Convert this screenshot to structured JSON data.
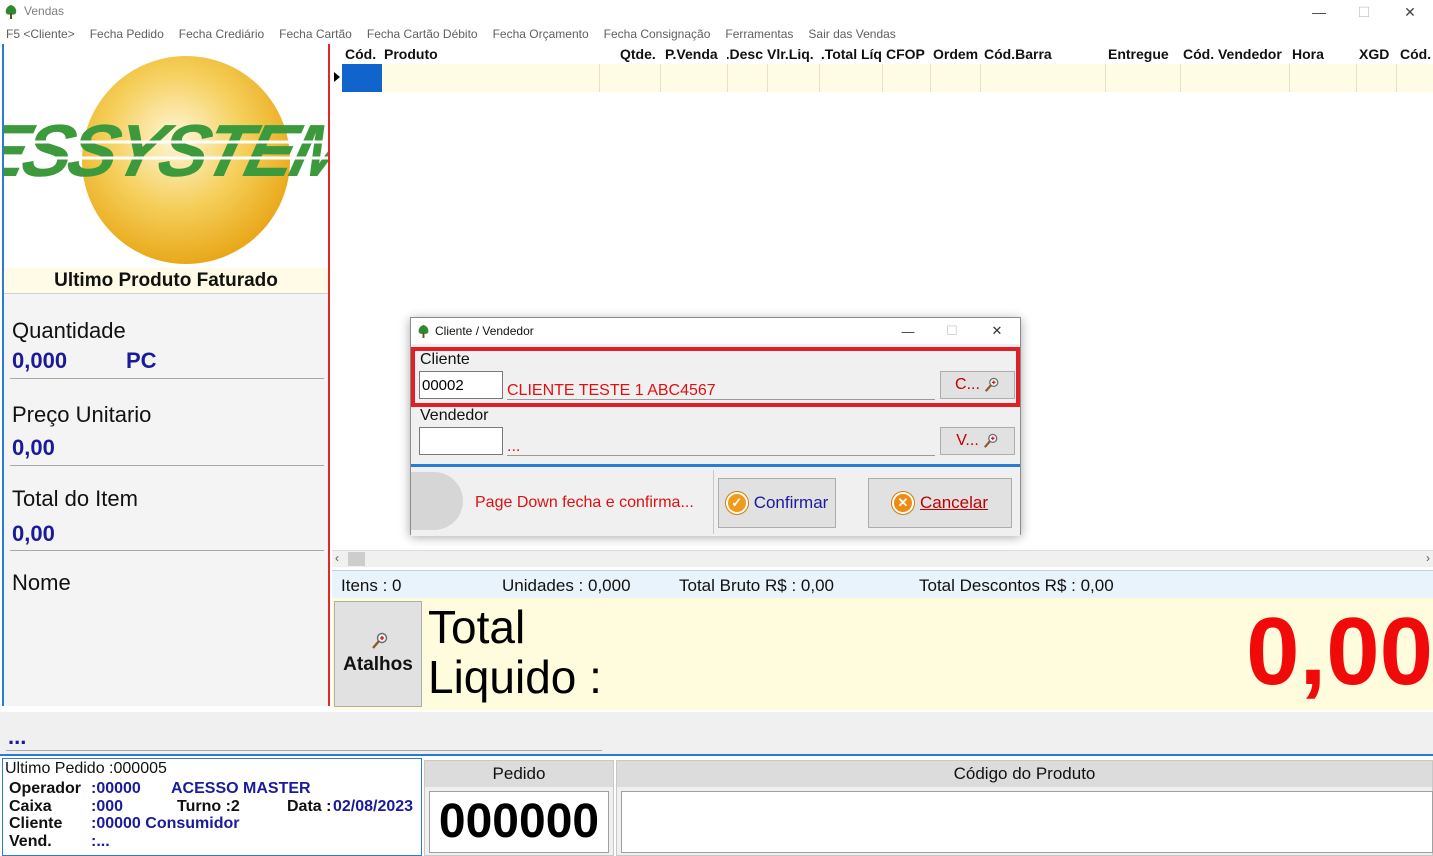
{
  "window": {
    "title": "Vendas",
    "minimize": "—",
    "maximize": "☐",
    "close": "✕"
  },
  "menu": [
    "F5 <Cliente>",
    "Fecha Pedido",
    "Fecha Crediário",
    "Fecha Cartão",
    "Fecha Cartão Débito",
    "Fecha Orçamento",
    "Fecha Consignação",
    "Ferramentas",
    "Sair das Vendas"
  ],
  "left_panel": {
    "last_product_title": "Ultimo Produto Faturado",
    "quantidade_label": "Quantidade",
    "quantidade_value": "0,000",
    "unit": "PC",
    "preco_label": "Preço Unitario",
    "preco_value": "0,00",
    "total_item_label": "Total do Item",
    "total_item_value": "0,00",
    "nome_label": "Nome"
  },
  "grid": {
    "columns": [
      "Cód.",
      "Produto",
      "Qtde.",
      "P.Venda",
      "Desc.",
      "Vlr.Liq.",
      "Total Líq.",
      "CFOP",
      "Ordem",
      "Cód.Barra",
      "Entregue",
      "Cód. Vendedor",
      "Hora",
      "XGD",
      "Cód."
    ]
  },
  "totals": {
    "itens": "Itens : 0",
    "unidades": "Unidades : 0,000",
    "total_bruto": "Total Bruto R$ : 0,00",
    "total_descontos": "Total Descontos R$ : 0,00"
  },
  "liquido": {
    "atalhos_label": "Atalhos",
    "label_line1": "Total",
    "label_line2": "Liquido :",
    "value": "0,00"
  },
  "status_text": "...",
  "info": {
    "ultimo_pedido": "Ultimo Pedido :000005",
    "operador_label": "Operador",
    "operador_value": ":00000",
    "operador_name": "ACESSO MASTER",
    "caixa_label": "Caixa",
    "caixa_value": ":000",
    "turno": "Turno :2",
    "data_label": "Data :",
    "data_value": "02/08/2023",
    "cliente_label": "Cliente",
    "cliente_value": ":00000 Consumidor",
    "vend_label": "Vend.",
    "vend_value": ":..."
  },
  "pedido": {
    "label": "Pedido",
    "value": "000000"
  },
  "codigo_produto": {
    "label": "Código do Produto",
    "value": ""
  },
  "dialog": {
    "title": "Cliente / Vendedor",
    "cliente_label": "Cliente",
    "cliente_code": "00002",
    "cliente_name": "CLIENTE TESTE 1 ABC4567",
    "cliente_btn": "C...",
    "vendedor_label": "Vendedor",
    "vendedor_code": "",
    "vendedor_name": "...",
    "vendedor_btn": "V...",
    "hint": "Page Down fecha e confirma...",
    "confirm_label": "Confirmar",
    "cancel_label": "Cancelar"
  },
  "colors": {
    "accent_blue": "#2b7bd6",
    "alert_red": "#e01f26",
    "value_blue": "#1a1a9c"
  },
  "icons": {
    "app": "tree-icon",
    "lookup": "magnifier-icon",
    "confirm": "check-circle-icon",
    "cancel": "x-circle-icon"
  }
}
